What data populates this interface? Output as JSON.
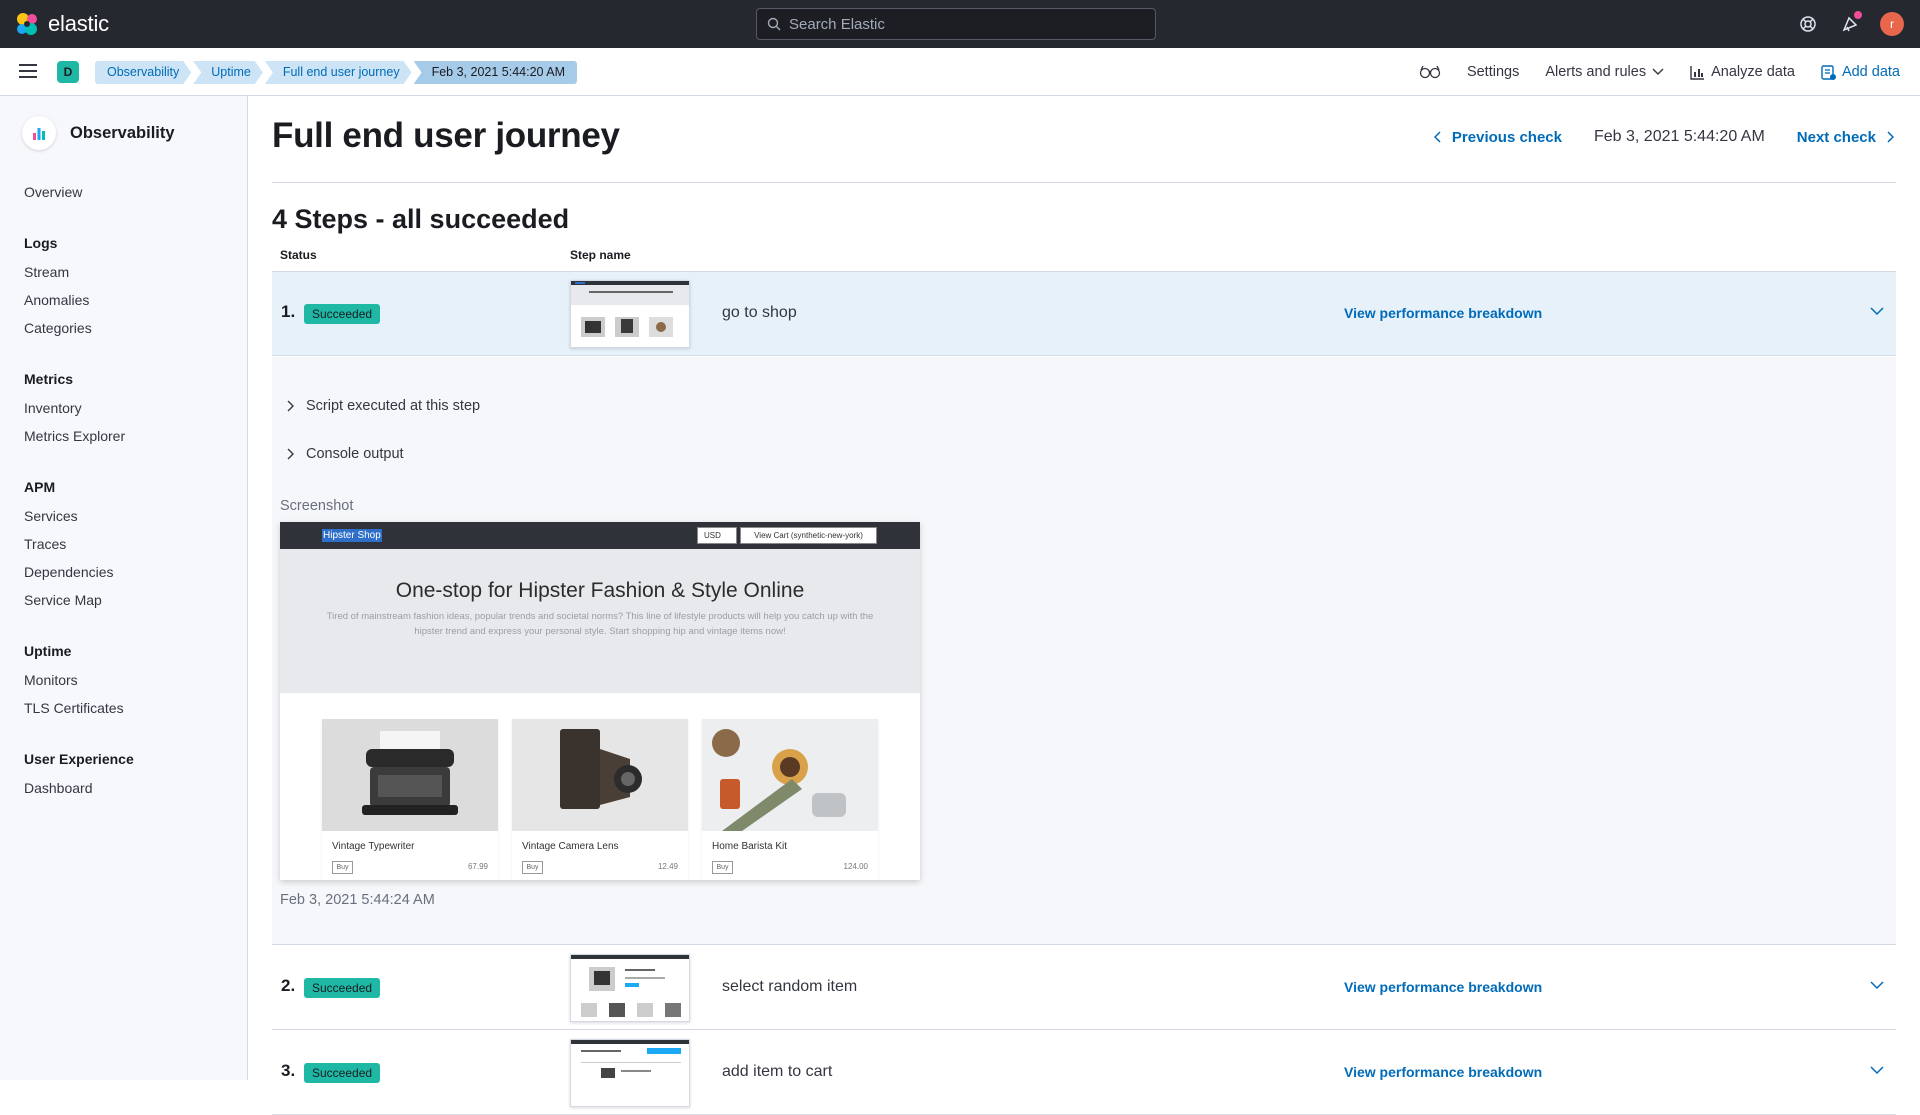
{
  "topbar": {
    "brand": "elastic",
    "search_placeholder": "Search Elastic",
    "avatar_initial": "r"
  },
  "subbar": {
    "space_initial": "D",
    "breadcrumbs": [
      "Observability",
      "Uptime",
      "Full end user journey",
      "Feb 3, 2021 5:44:20 AM"
    ],
    "settings": "Settings",
    "alerts": "Alerts and rules",
    "analyze": "Analyze data",
    "add_data": "Add data"
  },
  "sidebar": {
    "title": "Observability",
    "overview": "Overview",
    "groups": [
      {
        "label": "Logs",
        "items": [
          "Stream",
          "Anomalies",
          "Categories"
        ]
      },
      {
        "label": "Metrics",
        "items": [
          "Inventory",
          "Metrics Explorer"
        ]
      },
      {
        "label": "APM",
        "items": [
          "Services",
          "Traces",
          "Dependencies",
          "Service Map"
        ]
      },
      {
        "label": "Uptime",
        "items": [
          "Monitors",
          "TLS Certificates"
        ]
      },
      {
        "label": "User Experience",
        "items": [
          "Dashboard"
        ]
      }
    ]
  },
  "main": {
    "title": "Full end user journey",
    "previous": "Previous check",
    "current_date": "Feb 3, 2021 5:44:20 AM",
    "next": "Next check",
    "steps_title": "4 Steps - all succeeded",
    "col_status": "Status",
    "col_step": "Step name",
    "perf_link": "View performance breakdown",
    "steps": [
      {
        "num": "1.",
        "status": "Succeeded",
        "name": "go to shop"
      },
      {
        "num": "2.",
        "status": "Succeeded",
        "name": "select random item"
      },
      {
        "num": "3.",
        "status": "Succeeded",
        "name": "add item to cart"
      }
    ],
    "expanded": {
      "script_label": "Script executed at this step",
      "console_label": "Console output",
      "screenshot_label": "Screenshot",
      "screenshot_date": "Feb 3, 2021 5:44:24 AM"
    }
  },
  "shot": {
    "brand": "Hipster Shop",
    "currency": "USD",
    "cart": "View Cart (synthetic-new-york)",
    "headline": "One-stop for Hipster Fashion & Style Online",
    "subtext": "Tired of mainstream fashion ideas, popular trends and societal norms? This line of lifestyle products will help you catch up with the hipster trend and express your personal style. Start shopping hip and vintage items now!",
    "buy": "Buy",
    "products": [
      {
        "name": "Vintage Typewriter",
        "price": "67.99"
      },
      {
        "name": "Vintage Camera Lens",
        "price": "12.49"
      },
      {
        "name": "Home Barista Kit",
        "price": "124.00"
      }
    ]
  },
  "colors": {
    "topbar": "#25282f",
    "link": "#006bb8",
    "success": "#1fb8a5",
    "breadcrumb": "#cce4f5"
  }
}
